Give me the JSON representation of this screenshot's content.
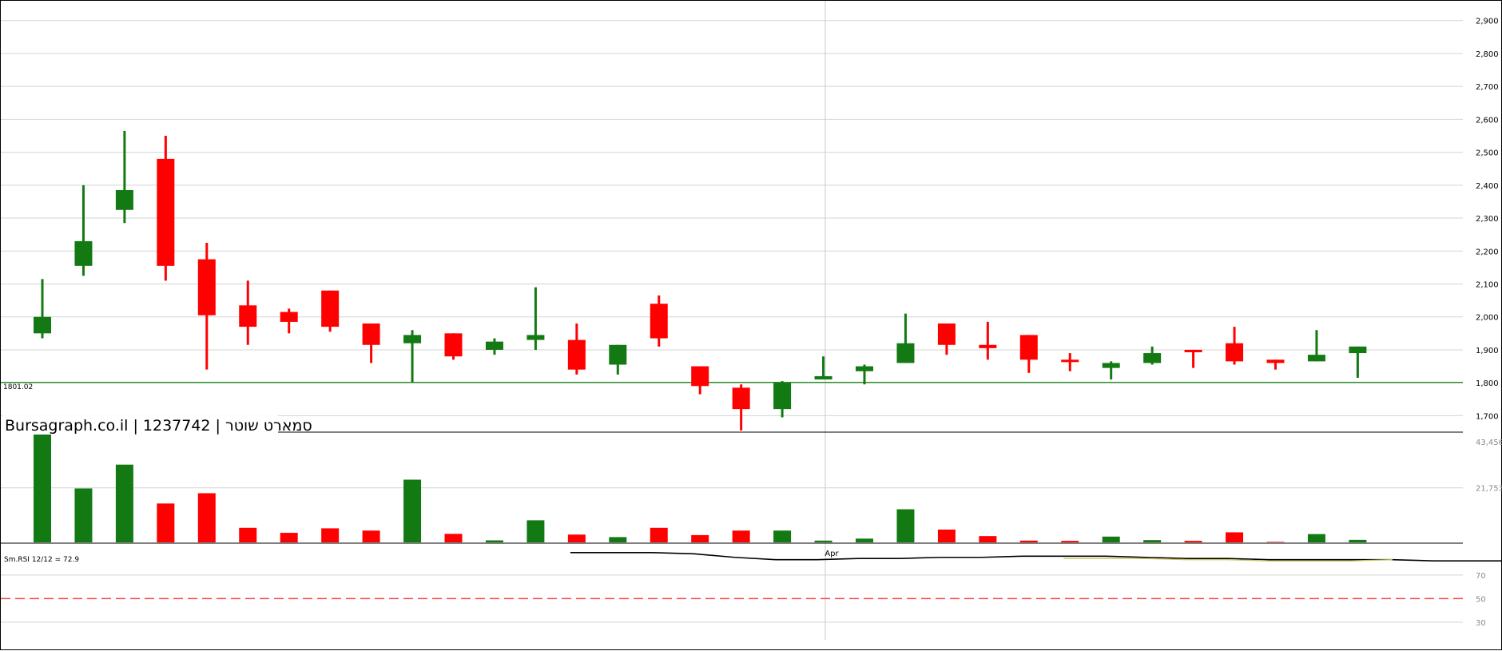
{
  "colors": {
    "up": "#137a13",
    "down": "#ff0000",
    "support": "#2e8b2e",
    "rsi_line": "#000000",
    "rsi_signal": "#c8c864",
    "rsi_ref": "#ff4444",
    "grid": "#d4d4d4"
  },
  "chart_data": [
    {
      "type": "candlestick",
      "title": "Bursagraph.co.il | 1237742 | סמארט שוטר",
      "ylim": [
        1650,
        2960
      ],
      "y_ticks": [
        "1,700",
        "1,800",
        "1,900",
        "2,000",
        "2,100",
        "2,200",
        "2,300",
        "2,400",
        "2,500",
        "2,600",
        "2,700",
        "2,800",
        "2,900"
      ],
      "y_tick_values": [
        1700,
        1800,
        1900,
        2000,
        2100,
        2200,
        2300,
        2400,
        2500,
        2600,
        2700,
        2800,
        2900
      ],
      "support_level": 1801.02,
      "support_label": "1801.02",
      "x_label_month": "Apr",
      "candles": [
        {
          "o": 1950,
          "h": 2115,
          "l": 1935,
          "c": 2000
        },
        {
          "o": 2155,
          "h": 2400,
          "l": 2125,
          "c": 2230
        },
        {
          "o": 2325,
          "h": 2565,
          "l": 2285,
          "c": 2385
        },
        {
          "o": 2480,
          "h": 2550,
          "l": 2110,
          "c": 2155
        },
        {
          "o": 2175,
          "h": 2225,
          "l": 1840,
          "c": 2005
        },
        {
          "o": 2035,
          "h": 2110,
          "l": 1915,
          "c": 1970
        },
        {
          "o": 2015,
          "h": 2025,
          "l": 1950,
          "c": 1985
        },
        {
          "o": 2080,
          "h": 2080,
          "l": 1955,
          "c": 1970
        },
        {
          "o": 1980,
          "h": 1980,
          "l": 1860,
          "c": 1915
        },
        {
          "o": 1920,
          "h": 1960,
          "l": 1800,
          "c": 1945
        },
        {
          "o": 1950,
          "h": 1950,
          "l": 1870,
          "c": 1880
        },
        {
          "o": 1900,
          "h": 1935,
          "l": 1885,
          "c": 1925
        },
        {
          "o": 1930,
          "h": 2090,
          "l": 1900,
          "c": 1945
        },
        {
          "o": 1930,
          "h": 1980,
          "l": 1825,
          "c": 1840
        },
        {
          "o": 1855,
          "h": 1915,
          "l": 1825,
          "c": 1915
        },
        {
          "o": 2040,
          "h": 2065,
          "l": 1910,
          "c": 1935
        },
        {
          "o": 1850,
          "h": 1850,
          "l": 1765,
          "c": 1790
        },
        {
          "o": 1785,
          "h": 1795,
          "l": 1655,
          "c": 1720
        },
        {
          "o": 1720,
          "h": 1805,
          "l": 1695,
          "c": 1800
        },
        {
          "o": 1810,
          "h": 1880,
          "l": 1810,
          "c": 1820
        },
        {
          "o": 1835,
          "h": 1855,
          "l": 1795,
          "c": 1850
        },
        {
          "o": 1860,
          "h": 2010,
          "l": 1860,
          "c": 1920
        },
        {
          "o": 1980,
          "h": 1980,
          "l": 1885,
          "c": 1915
        },
        {
          "o": 1915,
          "h": 1985,
          "l": 1870,
          "c": 1905
        },
        {
          "o": 1945,
          "h": 1945,
          "l": 1830,
          "c": 1870
        },
        {
          "o": 1870,
          "h": 1890,
          "l": 1835,
          "c": 1865
        },
        {
          "o": 1845,
          "h": 1865,
          "l": 1810,
          "c": 1860
        },
        {
          "o": 1860,
          "h": 1910,
          "l": 1855,
          "c": 1890
        },
        {
          "o": 1900,
          "h": 1900,
          "l": 1845,
          "c": 1895
        },
        {
          "o": 1920,
          "h": 1970,
          "l": 1855,
          "c": 1865
        },
        {
          "o": 1870,
          "h": 1870,
          "l": 1840,
          "c": 1860
        },
        {
          "o": 1865,
          "h": 1960,
          "l": 1865,
          "c": 1885
        },
        {
          "o": 1890,
          "h": 1910,
          "l": 1815,
          "c": 1910
        }
      ]
    },
    {
      "type": "bar",
      "name": "volume",
      "ylim": [
        0,
        43000
      ],
      "y_ticks": [
        "43,456",
        "21,753"
      ],
      "values": [
        43000,
        21500,
        31000,
        15500,
        19600,
        5800,
        3800,
        5600,
        4700,
        25000,
        3400,
        800,
        8800,
        3100,
        2100,
        5800,
        2900,
        4700,
        4700,
        700,
        1500,
        13200,
        5100,
        2500,
        700,
        600,
        2300,
        900,
        600,
        4000,
        200,
        3300,
        1000
      ]
    },
    {
      "type": "line",
      "name": "Sm.RSI",
      "label": "Sm.RSI 12/12 = 72.9",
      "ylim": [
        15,
        95
      ],
      "y_ticks": [
        "70",
        "50",
        "30"
      ],
      "y_tick_values": [
        70,
        50,
        30
      ],
      "reference_level": 50,
      "x_start_index": 13,
      "values": [
        89,
        89,
        89,
        88,
        85,
        83,
        83,
        84,
        84,
        85,
        85,
        86,
        86,
        86,
        85,
        84,
        84,
        83,
        83,
        83,
        83,
        82,
        82,
        82
      ],
      "signal_start_index": 25,
      "signal_values": [
        84,
        84,
        84,
        83,
        83,
        82,
        82,
        82,
        83
      ]
    }
  ]
}
